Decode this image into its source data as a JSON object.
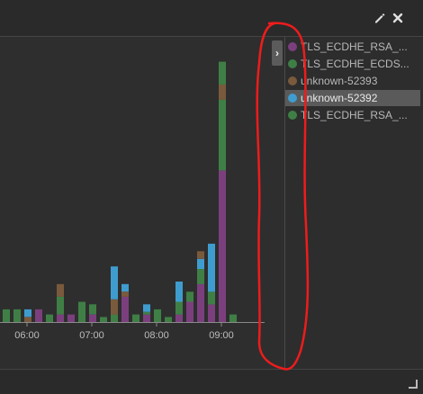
{
  "toolbar": {
    "edit_icon": "pencil-icon",
    "close_icon": "close-icon"
  },
  "legend": {
    "toggle_icon": "chevron-right-icon",
    "items": [
      {
        "label": "TLS_ECDHE_RSA_...",
        "color": "#7b3f7e"
      },
      {
        "label": "TLS_ECDHE_ECDS...",
        "color": "#3f7f46"
      },
      {
        "label": "unknown-52393",
        "color": "#7a5a3c"
      },
      {
        "label": "unknown-52392",
        "color": "#3f9ccf",
        "selected": true
      },
      {
        "label": "TLS_ECDHE_RSA_...",
        "color": "#3f7f46"
      }
    ]
  },
  "chart_data": {
    "type": "bar",
    "stacked": true,
    "x_ticks": [
      "06:00",
      "07:00",
      "08:00",
      "09:00"
    ],
    "series_colors": {
      "purple": "#7b3f7e",
      "green": "#3f7f46",
      "brown": "#7a5a3c",
      "blue": "#3f9ccf"
    },
    "bars": [
      {
        "x": 0.5,
        "segments": [
          [
            "green",
            1
          ]
        ]
      },
      {
        "x": 1.5,
        "segments": [
          [
            "green",
            1
          ]
        ]
      },
      {
        "x": 2.5,
        "segments": [
          [
            "brown",
            0.4
          ],
          [
            "blue",
            0.6
          ]
        ]
      },
      {
        "x": 3.5,
        "segments": [
          [
            "purple",
            1
          ]
        ]
      },
      {
        "x": 4.5,
        "segments": [
          [
            "green",
            0.6
          ]
        ]
      },
      {
        "x": 5.5,
        "segments": [
          [
            "purple",
            0.6
          ],
          [
            "green",
            1.4
          ],
          [
            "brown",
            1
          ]
        ]
      },
      {
        "x": 6.5,
        "segments": [
          [
            "purple",
            0.6
          ]
        ]
      },
      {
        "x": 7.5,
        "segments": [
          [
            "green",
            1.6
          ]
        ]
      },
      {
        "x": 8.5,
        "segments": [
          [
            "purple",
            0.6
          ],
          [
            "green",
            0.8
          ]
        ]
      },
      {
        "x": 9.5,
        "segments": [
          [
            "green",
            0.4
          ]
        ]
      },
      {
        "x": 10.5,
        "segments": [
          [
            "green",
            0.6
          ],
          [
            "brown",
            1.2
          ],
          [
            "blue",
            2.6
          ]
        ]
      },
      {
        "x": 11.5,
        "segments": [
          [
            "purple",
            2
          ],
          [
            "brown",
            0.4
          ],
          [
            "blue",
            0.6
          ]
        ]
      },
      {
        "x": 12.5,
        "segments": [
          [
            "green",
            0.6
          ]
        ]
      },
      {
        "x": 13.5,
        "segments": [
          [
            "purple",
            0.6
          ],
          [
            "green",
            0.2
          ],
          [
            "blue",
            0.6
          ]
        ]
      },
      {
        "x": 14.5,
        "segments": [
          [
            "green",
            1
          ]
        ]
      },
      {
        "x": 15.5,
        "segments": [
          [
            "green",
            0.4
          ]
        ]
      },
      {
        "x": 16.5,
        "segments": [
          [
            "purple",
            0.6
          ],
          [
            "green",
            1
          ],
          [
            "blue",
            1.6
          ]
        ]
      },
      {
        "x": 17.5,
        "segments": [
          [
            "purple",
            1.6
          ],
          [
            "green",
            0.8
          ]
        ]
      },
      {
        "x": 18.5,
        "segments": [
          [
            "purple",
            3
          ],
          [
            "green",
            1.2
          ],
          [
            "blue",
            0.8
          ],
          [
            "brown",
            0.6
          ]
        ]
      },
      {
        "x": 19.5,
        "segments": [
          [
            "purple",
            1.4
          ],
          [
            "green",
            1
          ],
          [
            "blue",
            3.8
          ]
        ]
      },
      {
        "x": 20.5,
        "segments": [
          [
            "purple",
            12
          ],
          [
            "green",
            5.6
          ],
          [
            "brown",
            1.2
          ],
          [
            "green",
            1.8
          ]
        ]
      },
      {
        "x": 21.5,
        "segments": [
          [
            "green",
            0.6
          ]
        ]
      }
    ],
    "ylim": [
      0,
      20
    ]
  }
}
